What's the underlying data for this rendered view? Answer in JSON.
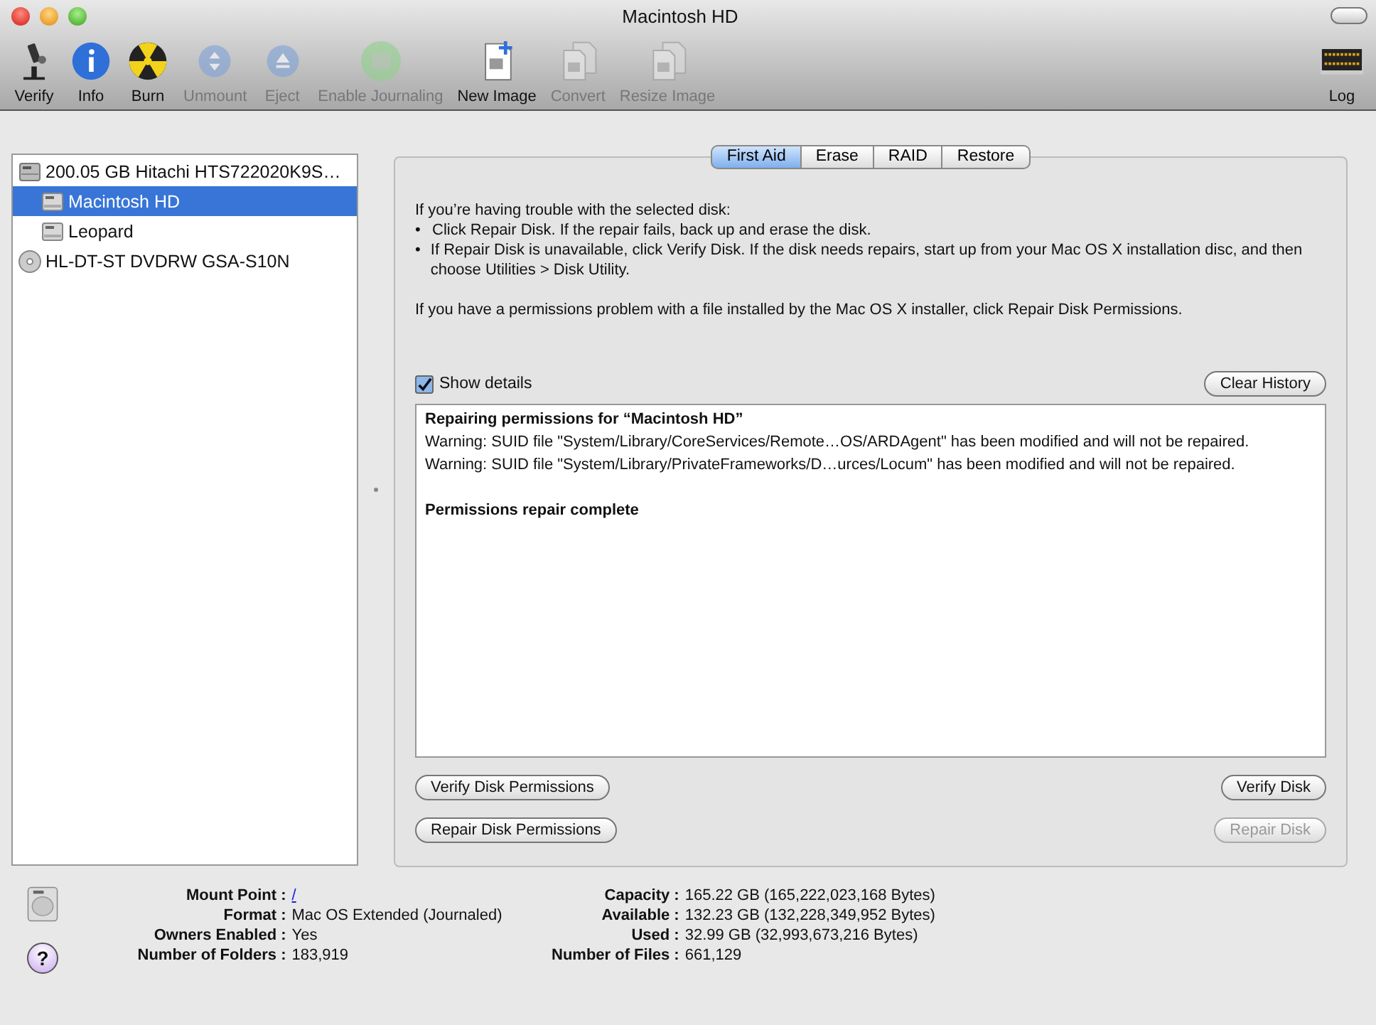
{
  "window": {
    "title": "Macintosh HD"
  },
  "toolbar": [
    {
      "label": "Verify",
      "kind": "microscope",
      "disabled": false
    },
    {
      "label": "Info",
      "kind": "info",
      "disabled": false
    },
    {
      "label": "Burn",
      "kind": "burn",
      "disabled": false
    },
    {
      "label": "Unmount",
      "kind": "unmount",
      "disabled": true
    },
    {
      "label": "Eject",
      "kind": "eject",
      "disabled": true
    },
    {
      "label": "Enable Journaling",
      "kind": "journal",
      "disabled": true
    },
    {
      "label": "New Image",
      "kind": "newimage",
      "disabled": false
    },
    {
      "label": "Convert",
      "kind": "convert",
      "disabled": true
    },
    {
      "label": "Resize Image",
      "kind": "resize",
      "disabled": true
    }
  ],
  "log_button": {
    "label": "Log",
    "disabled": false
  },
  "sidebar": {
    "items": [
      {
        "label": "200.05 GB Hitachi HTS722020K9S…",
        "kind": "disk",
        "selected": false,
        "children": [
          {
            "label": "Macintosh HD",
            "kind": "volume",
            "selected": true
          },
          {
            "label": "Leopard",
            "kind": "volume",
            "selected": false
          }
        ]
      },
      {
        "label": "HL-DT-ST DVDRW GSA-S10N",
        "kind": "optical",
        "selected": false
      }
    ]
  },
  "tabs": [
    {
      "label": "First Aid",
      "selected": true
    },
    {
      "label": "Erase",
      "selected": false
    },
    {
      "label": "RAID",
      "selected": false
    },
    {
      "label": "Restore",
      "selected": false
    }
  ],
  "instructions": {
    "intro": "If you’re having trouble with the selected disk:",
    "bullets": [
      {
        "bullet": "•",
        "text": "Click Repair Disk. If the repair fails, back up and erase the disk."
      },
      {
        "bullet": "•",
        "text": "If Repair Disk is unavailable, click Verify Disk. If the disk needs repairs, start up from your Mac OS X installation disc, and then choose Utilities > Disk Utility."
      }
    ],
    "permissions_note": "If you have a permissions problem with a file installed by the Mac OS X installer, click Repair Disk Permissions."
  },
  "show_details": {
    "label": "Show details",
    "checked": true
  },
  "clear_history": {
    "label": "Clear History",
    "disabled": false
  },
  "log": [
    {
      "kind": "heading",
      "text": "Repairing permissions for “Macintosh HD”"
    },
    {
      "kind": "line",
      "text": "Warning: SUID file \"System/Library/CoreServices/Remote…OS/ARDAgent\" has been modified and will not be repaired."
    },
    {
      "kind": "line",
      "text": "Warning: SUID file \"System/Library/PrivateFrameworks/D…urces/Locum\" has been modified and will not be repaired."
    },
    {
      "kind": "gap"
    },
    {
      "kind": "heading",
      "text": "Permissions repair complete"
    }
  ],
  "actions": [
    [
      {
        "label": "Verify Disk Permissions",
        "disabled": false
      },
      {
        "label": "Verify Disk",
        "disabled": false
      }
    ],
    [
      {
        "label": "Repair Disk Permissions",
        "disabled": false
      },
      {
        "label": "Repair Disk",
        "disabled": true
      }
    ]
  ],
  "info": {
    "left": [
      {
        "label": "Mount Point :",
        "value": "/",
        "kind": "link"
      },
      {
        "label": "Format :",
        "value": "Mac OS Extended (Journaled)",
        "kind": "text"
      },
      {
        "label": "Owners Enabled :",
        "value": "Yes",
        "kind": "text"
      },
      {
        "label": "Number of Folders :",
        "value": "183,919",
        "kind": "text"
      }
    ],
    "right": [
      {
        "label": "Capacity :",
        "value": "165.22 GB (165,222,023,168 Bytes)"
      },
      {
        "label": "Available :",
        "value": "132.23 GB (132,228,349,952 Bytes)"
      },
      {
        "label": "Used :",
        "value": "32.99 GB (32,993,673,216 Bytes)"
      },
      {
        "label": "Number of Files :",
        "value": "661,129"
      }
    ]
  },
  "help_button": {
    "label": "?"
  }
}
